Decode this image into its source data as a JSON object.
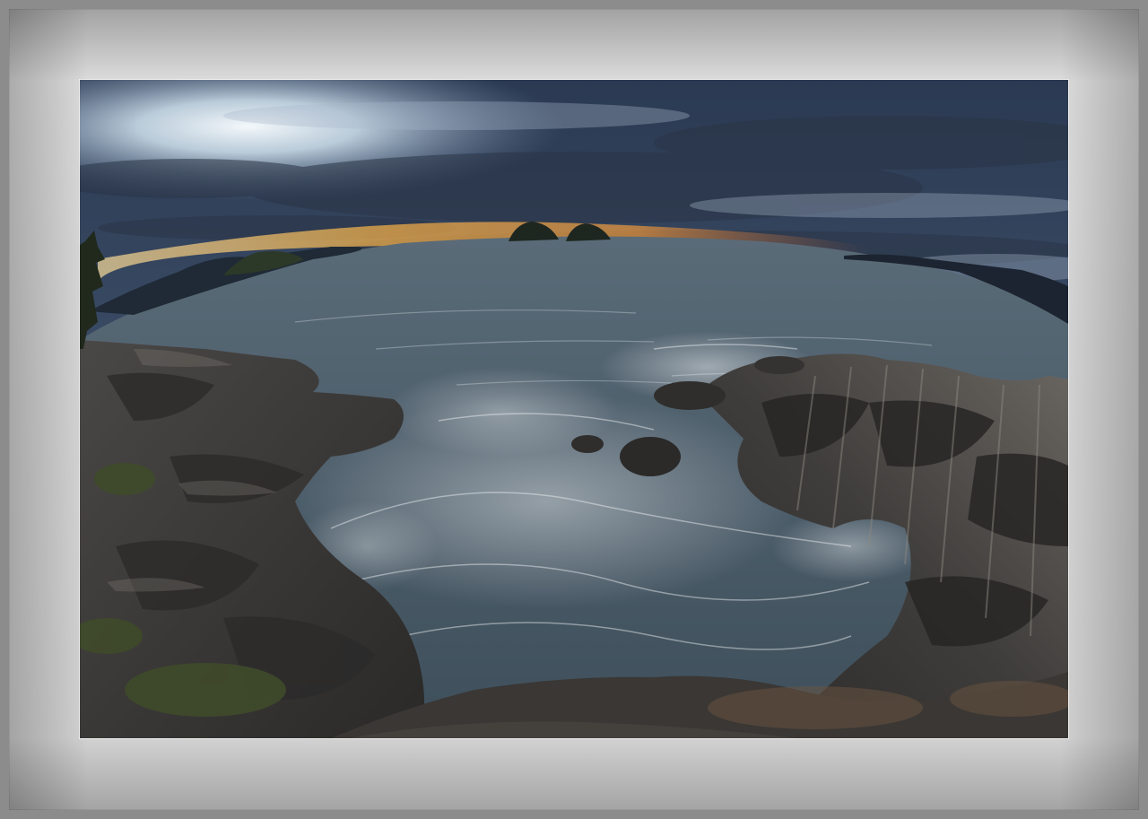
{
  "image": {
    "subject": "fisheye-coastal-sunset",
    "colors": {
      "frame_outer": "#8c8c8c",
      "mat_light": "#dcdcdc",
      "sky_dark": "#2f3e55",
      "sky_glow": "#e9f2f6",
      "horizon_orange": "#f2a23a",
      "sea": "#4a5c68",
      "rock": "#3a3a3a"
    }
  }
}
